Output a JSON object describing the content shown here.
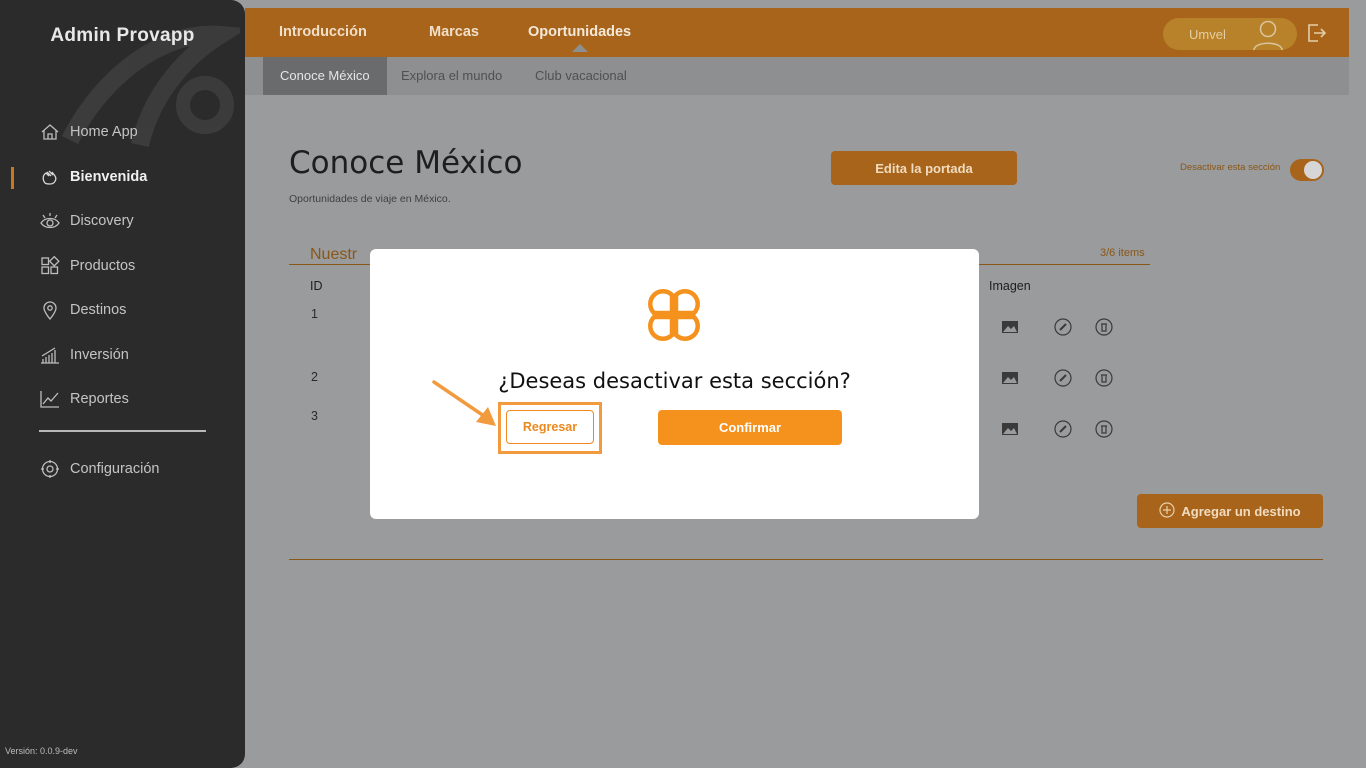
{
  "sidebar": {
    "brand": "Admin Provapp",
    "items": [
      {
        "label": "Home App",
        "icon": "home-icon"
      },
      {
        "label": "Bienvenida",
        "icon": "waving-hand-icon",
        "active": true
      },
      {
        "label": "Discovery",
        "icon": "eye-icon"
      },
      {
        "label": "Productos",
        "icon": "products-grid-icon"
      },
      {
        "label": "Destinos",
        "icon": "location-pin-icon"
      },
      {
        "label": "Inversión",
        "icon": "bar-chart-icon"
      },
      {
        "label": "Reportes",
        "icon": "line-chart-icon"
      }
    ],
    "config_label": "Configuración",
    "version": "Versión: 0.0.9-dev"
  },
  "topbar": {
    "tabs": [
      "Introducción",
      "Marcas",
      "Oportunidades"
    ],
    "active_tab": "Oportunidades",
    "user_name": "Umvel"
  },
  "subnav": {
    "tabs": [
      "Conoce México",
      "Explora el mundo",
      "Club vacacional"
    ],
    "active_tab": "Conoce México"
  },
  "main": {
    "title": "Conoce México",
    "subtitle": "Oportunidades de viaje en México.",
    "edit_cover_label": "Edita la portada",
    "deactivate_label": "Desactivar esta sección",
    "section_title": "Nuestr",
    "items_count": "3/6 items",
    "col_id": "ID",
    "col_image": "Imagen",
    "rows": [
      {
        "id": "1"
      },
      {
        "id": "2"
      },
      {
        "id": "3"
      }
    ],
    "add_destination_label": "Agregar un destino"
  },
  "modal": {
    "question": "¿Deseas desactivar esta sección?",
    "back_label": "Regresar",
    "confirm_label": "Confirmar"
  },
  "colors": {
    "brand_orange": "#f5921e",
    "topbar": "#a8641a",
    "sidebar": "#2b2b2b"
  }
}
